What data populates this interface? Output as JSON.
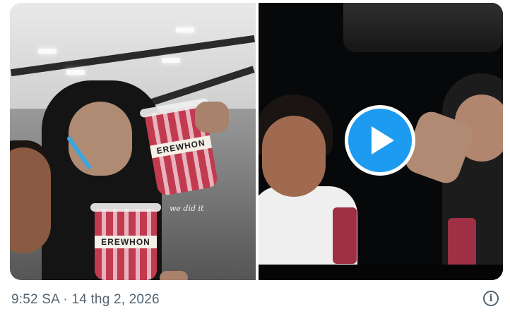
{
  "media": {
    "photo": {
      "caption": "we did it",
      "cup_brand": "EREWHON"
    },
    "video": {
      "play_icon": "play-icon"
    }
  },
  "footer": {
    "timestamp": "9:52 SA · 14 thg 2, 2026",
    "info_icon": "info-icon"
  },
  "colors": {
    "accent": "#1d9bf0",
    "muted_text": "#536471",
    "background": "#ffffff"
  }
}
